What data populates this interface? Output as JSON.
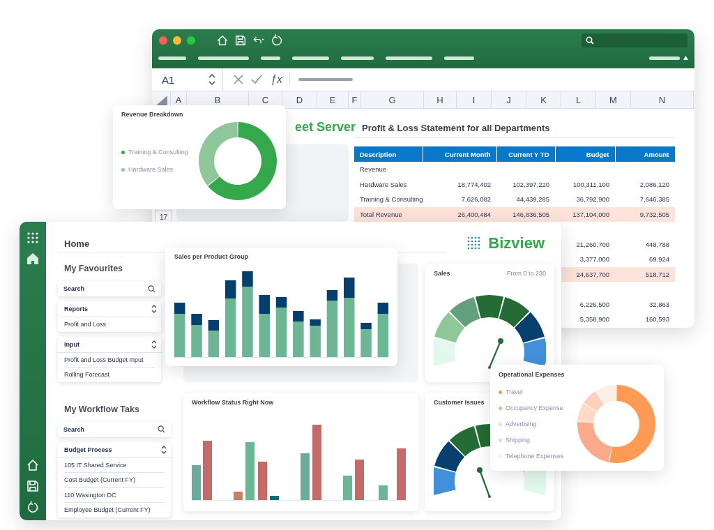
{
  "spreadsheet": {
    "name_box": "A1",
    "function_label": "ƒx",
    "columns": [
      "A",
      "B",
      "C",
      "D",
      "E",
      "F",
      "G",
      "H",
      "I",
      "J",
      "K",
      "L",
      "M",
      "N"
    ],
    "row_numbers": [
      "17"
    ],
    "sheet_title": "eet Server",
    "report": {
      "title": "Profit & Loss Statement for all Departments",
      "columns": [
        "Description",
        "Current Month",
        "Current Y TD",
        "Budget",
        "Amount"
      ],
      "rows": [
        {
          "kind": "section",
          "label": "Revenue"
        },
        {
          "kind": "line",
          "label": "Hardware Sales",
          "values": [
            "18,774,402",
            "102,397,220",
            "100,311,100",
            "2,086,120"
          ]
        },
        {
          "kind": "line",
          "label": "Training & Consulting",
          "values": [
            "7,626,082",
            "44,439,285",
            "36,792,900",
            "7,646,385"
          ]
        },
        {
          "kind": "total",
          "label": "Total Revenue",
          "values": [
            "26,400,484",
            "146,836,505",
            "137,104,000",
            "9,732,505"
          ]
        },
        {
          "kind": "blank"
        },
        {
          "kind": "line",
          "values": [
            "21,260,700",
            "448,788"
          ]
        },
        {
          "kind": "line",
          "values": [
            "3,377,000",
            "69,924"
          ]
        },
        {
          "kind": "total",
          "values": [
            "24,637,700",
            "518,712"
          ]
        },
        {
          "kind": "blank"
        },
        {
          "kind": "line",
          "values": [
            "6,226,500",
            "32,863"
          ]
        },
        {
          "kind": "line",
          "values": [
            "5,358,900",
            "160,593"
          ]
        }
      ]
    }
  },
  "revenue_breakdown": {
    "title": "Revenue Breakdown",
    "legend": [
      {
        "label": "Training & Consulting",
        "color": "#34a84a"
      },
      {
        "label": "Hardware Sales",
        "color": "#8fc79a"
      }
    ]
  },
  "bizview": {
    "page_title": "Home",
    "logo": "Bizview",
    "sections": [
      {
        "heading": "My Favourites",
        "search": {
          "placeholder": "Search"
        },
        "groups": [
          {
            "title": "Reports",
            "items": [
              "Profit and Loss"
            ]
          },
          {
            "title": "Input",
            "items": [
              "Profit and Loss Budget Input",
              "Rolling Forecast"
            ]
          }
        ]
      },
      {
        "heading": "My Workflow Taks",
        "search": {
          "placeholder": "Search"
        },
        "groups": [
          {
            "title": "Budget Process",
            "items": [
              "105 IT Shared Service",
              "Cost Budget (Current FY)",
              "110 Wasington DC",
              "Employee Budget (Current FY)"
            ]
          }
        ]
      }
    ],
    "cards": [
      {
        "kind": "blank"
      },
      {
        "kind": "gauge",
        "title": "Sales",
        "subtitle": "From 0 to 230"
      },
      {
        "kind": "bars",
        "title": "Workflow Status Right Now"
      },
      {
        "kind": "gauge",
        "title": "Customer Issues"
      }
    ]
  },
  "sales_per_product_group": {
    "title": "Sales per Product Group"
  },
  "operational_expenses": {
    "title": "Operational Expenses",
    "legend": [
      {
        "label": "Travel",
        "color": "#fd9a53"
      },
      {
        "label": "Occupancy Expense",
        "color": "#fbaa8c"
      },
      {
        "label": "Advertising",
        "color": "#fdd9c6"
      },
      {
        "label": "Shipping",
        "color": "#fdd0bd"
      },
      {
        "label": "Telephone Expenses",
        "color": "#fdeee4"
      }
    ]
  }
}
